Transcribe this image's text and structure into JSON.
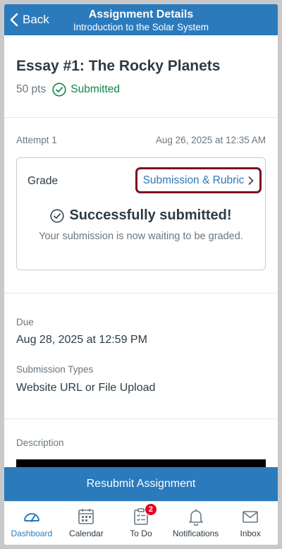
{
  "header": {
    "back_label": "Back",
    "title": "Assignment Details",
    "subtitle": "Introduction to the Solar System"
  },
  "assignment": {
    "title": "Essay #1: The Rocky Planets",
    "points": "50 pts",
    "status": "Submitted"
  },
  "attempt": {
    "label": "Attempt 1",
    "date": "Aug 26, 2025 at 12:35 AM"
  },
  "grade_card": {
    "label": "Grade",
    "link_label": "Submission & Rubric",
    "success_title": "Successfully submitted!",
    "success_message": "Your submission is now waiting to be graded."
  },
  "details": {
    "due_label": "Due",
    "due_value": "Aug 28, 2025 at 12:59 PM",
    "types_label": "Submission Types",
    "types_value": "Website URL or File Upload",
    "description_label": "Description"
  },
  "resubmit_label": "Resubmit Assignment",
  "tabs": [
    {
      "label": "Dashboard",
      "icon": "dashboard-icon",
      "active": true
    },
    {
      "label": "Calendar",
      "icon": "calendar-icon"
    },
    {
      "label": "To Do",
      "icon": "todo-icon",
      "badge": "2"
    },
    {
      "label": "Notifications",
      "icon": "bell-icon"
    },
    {
      "label": "Inbox",
      "icon": "inbox-icon"
    }
  ],
  "colors": {
    "brand": "#2b7abc",
    "success": "#0b874b",
    "highlight": "#7a1022",
    "badge": "#e0061f"
  }
}
